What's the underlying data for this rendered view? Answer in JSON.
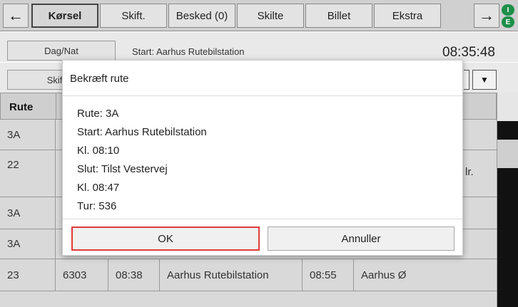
{
  "topbar": {
    "back_icon": "left-arrow-icon",
    "forward_icon": "right-arrow-icon",
    "tabs": [
      {
        "label": "Kørsel",
        "active": true
      },
      {
        "label": "Skift.",
        "active": false
      },
      {
        "label": "Besked (0)",
        "active": false
      },
      {
        "label": "Skilte",
        "active": false
      },
      {
        "label": "Billet",
        "active": false
      },
      {
        "label": "Ekstra",
        "active": false
      }
    ],
    "badge_top": "I",
    "badge_bottom": "E"
  },
  "row2": {
    "daynight_label": "Dag/Nat",
    "start_label": "Start: Aarhus Rutebilstation",
    "clock": "08:35:48"
  },
  "row3": {
    "shift_label": "Skift",
    "dropdown_icon": "chevron-down-icon"
  },
  "table": {
    "header_route": "Rute",
    "rows": [
      {
        "route": "3A"
      },
      {
        "route": "22",
        "trailing": "lr."
      },
      {
        "route": "3A"
      },
      {
        "route": "3A"
      },
      {
        "route": "23",
        "vehicle": "6303",
        "time": "08:38",
        "start": "Aarhus Rutebilstation",
        "end_time": "08:55",
        "dest": "Aarhus Ø"
      }
    ]
  },
  "dialog": {
    "title": "Bekræft rute",
    "lines": [
      "Rute: 3A",
      "Start: Aarhus Rutebilstation",
      "Kl. 08:10",
      "Slut: Tilst Vestervej",
      "Kl. 08:47",
      "Tur: 536"
    ],
    "ok_label": "OK",
    "cancel_label": "Annuller"
  },
  "colors": {
    "ok_highlight": "#e03b3b",
    "badge": "#1e8f4a"
  }
}
